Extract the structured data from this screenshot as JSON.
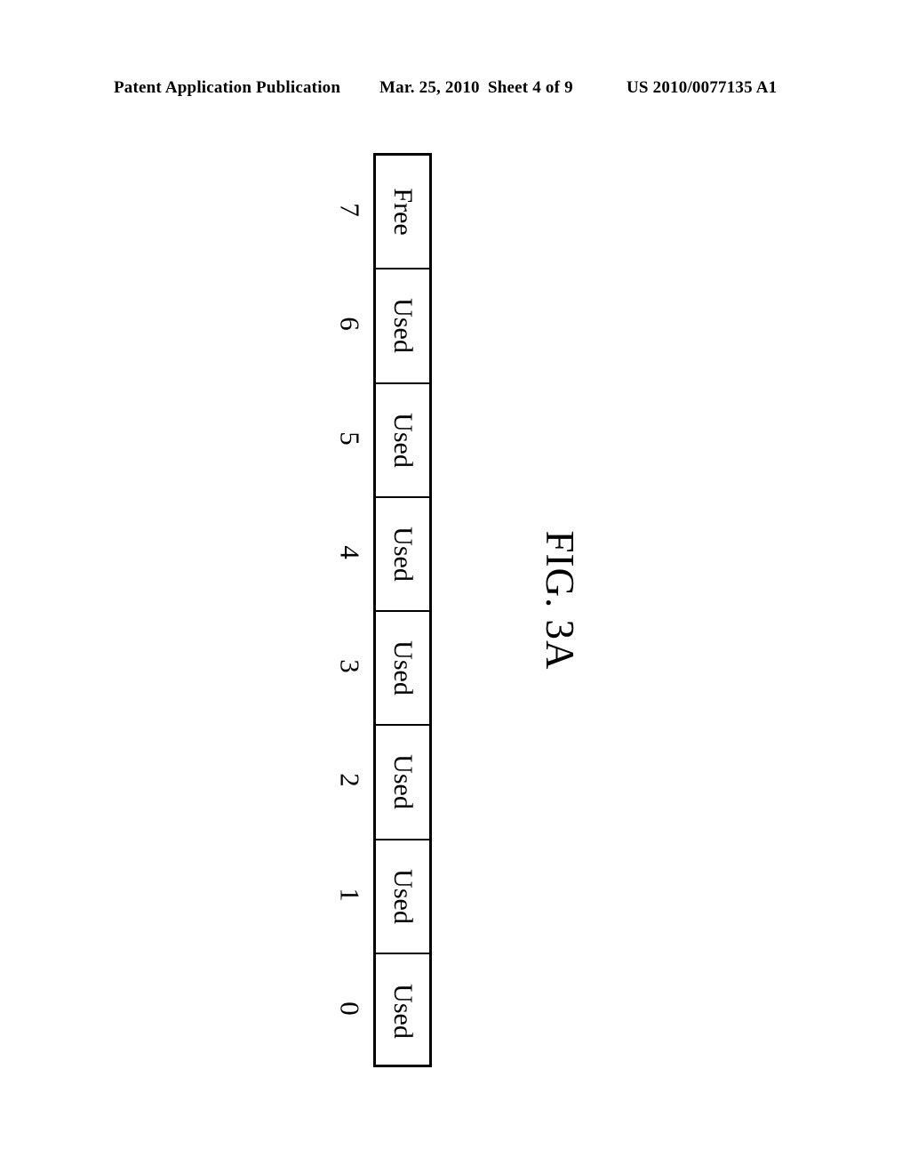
{
  "header": {
    "publication": "Patent Application Publication",
    "date": "Mar. 25, 2010",
    "sheet": "Sheet 4 of 9",
    "patent_number": "US 2010/0077135 A1"
  },
  "figure": {
    "caption": "FIG. 3A",
    "orientation_degrees": 90,
    "block_table": {
      "cells": [
        {
          "index": "7",
          "status": "Free"
        },
        {
          "index": "6",
          "status": "Used"
        },
        {
          "index": "5",
          "status": "Used"
        },
        {
          "index": "4",
          "status": "Used"
        },
        {
          "index": "3",
          "status": "Used"
        },
        {
          "index": "2",
          "status": "Used"
        },
        {
          "index": "1",
          "status": "Used"
        },
        {
          "index": "0",
          "status": "Used"
        }
      ]
    }
  },
  "colors": {
    "ink": "#000000",
    "paper": "#ffffff"
  }
}
